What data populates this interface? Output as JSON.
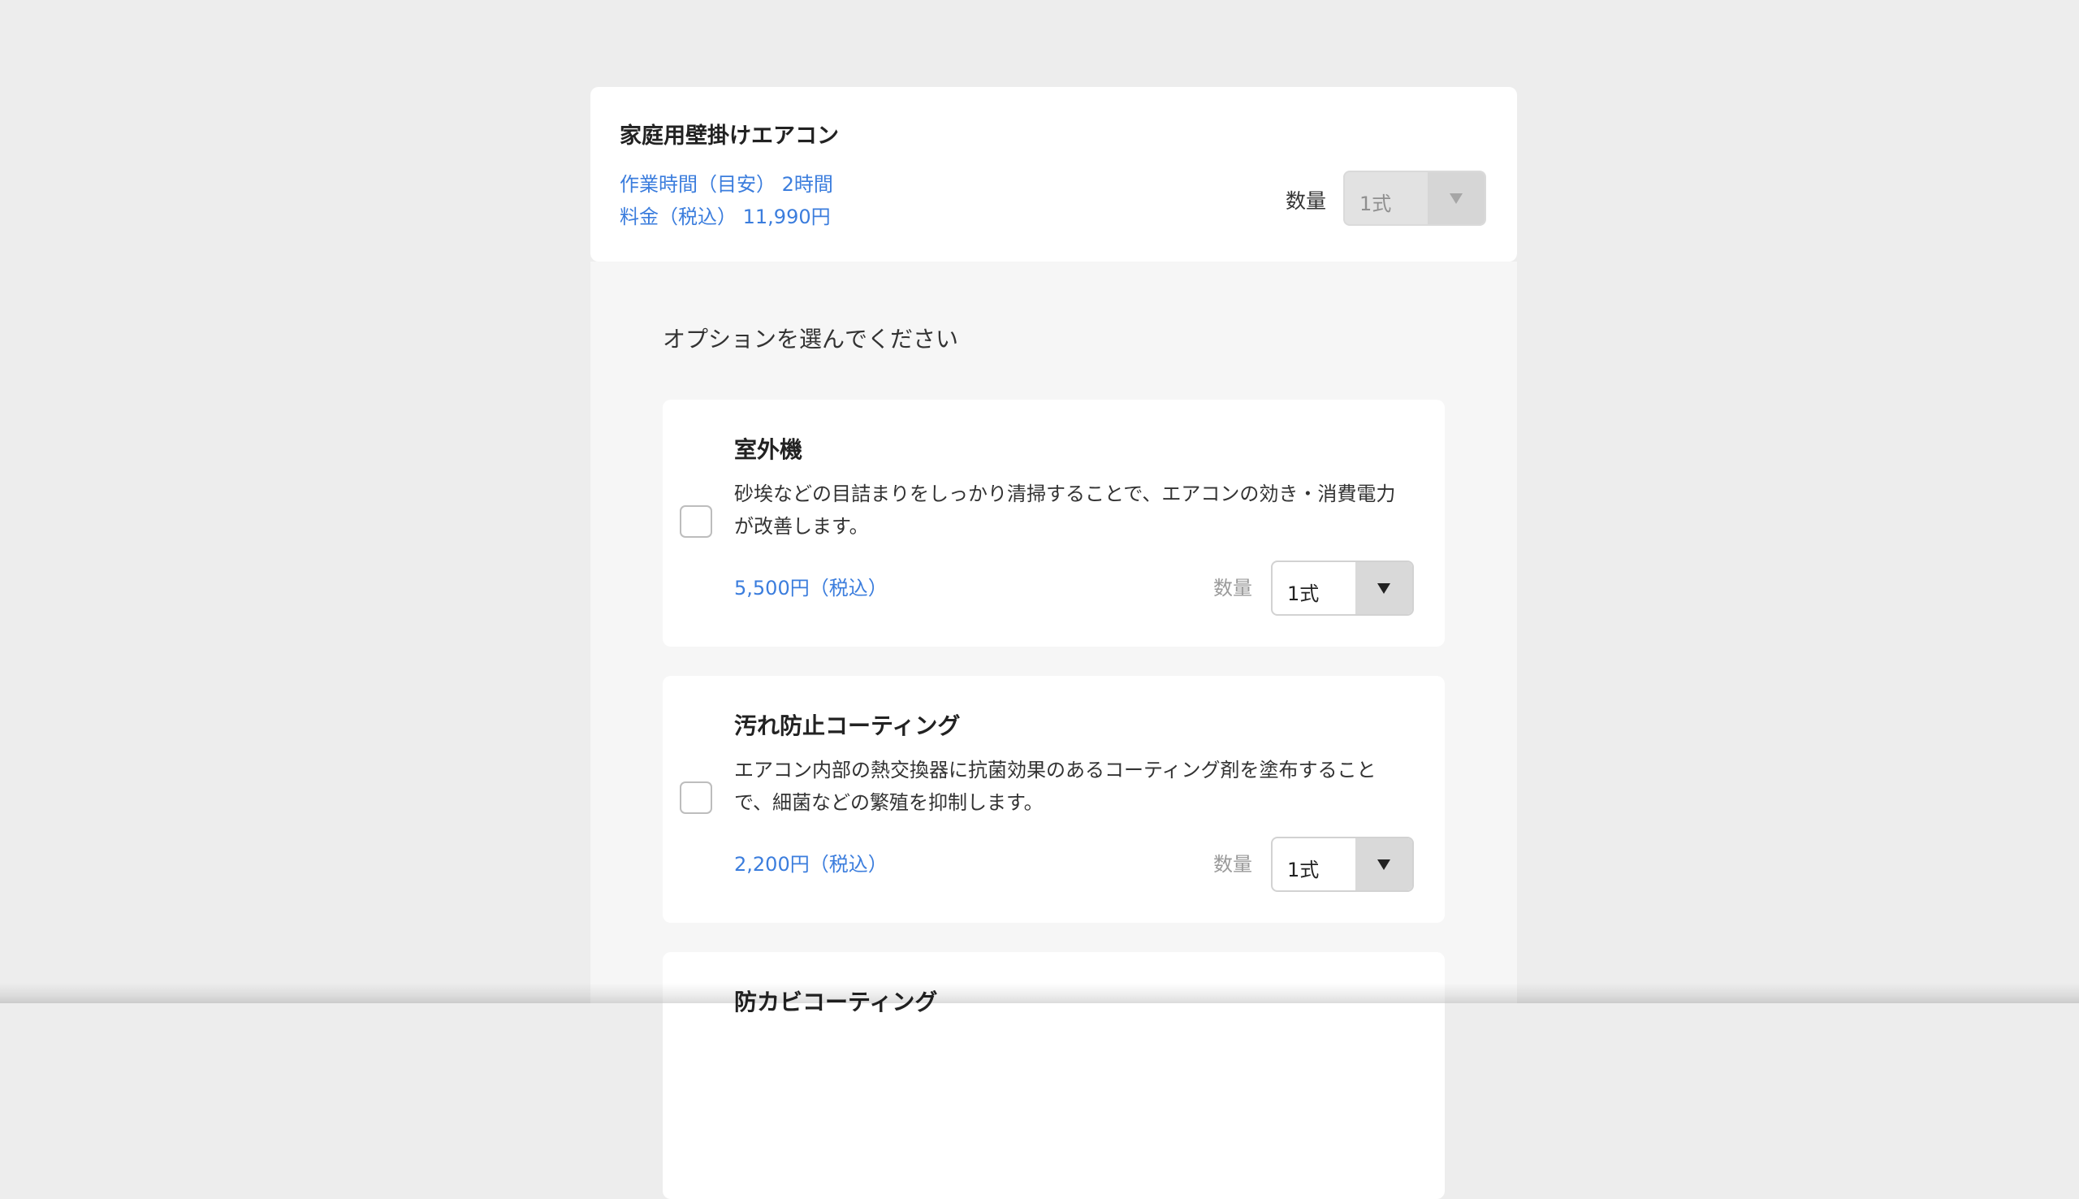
{
  "product": {
    "title": "家庭用壁掛けエアコン",
    "work_time": "作業時間（目安） 2時間",
    "price": "料金（税込） 11,990円",
    "quantity_label": "数量",
    "quantity_value": "1式",
    "quantity_disabled": true
  },
  "options": {
    "heading": "オプションを選んでください",
    "items": [
      {
        "title": "室外機",
        "description": "砂埃などの目詰まりをしっかり清掃することで、エアコンの効き・消費電力が改善します。",
        "price": "5,500円（税込）",
        "quantity_label": "数量",
        "quantity_value": "1式",
        "checked": false
      },
      {
        "title": "汚れ防止コーティング",
        "description": "エアコン内部の熱交換器に抗菌効果のあるコーティング剤を塗布することで、細菌などの繁殖を抑制します。",
        "price": "2,200円（税込）",
        "quantity_label": "数量",
        "quantity_value": "1式",
        "checked": false
      },
      {
        "title": "防カビコーティング"
      }
    ]
  },
  "icons": {
    "dropdown": "triangle-down-icon"
  },
  "colors": {
    "background": "#ededed",
    "card": "#ffffff",
    "panel": "#f6f6f6",
    "accent_text": "#3b7ddd"
  }
}
